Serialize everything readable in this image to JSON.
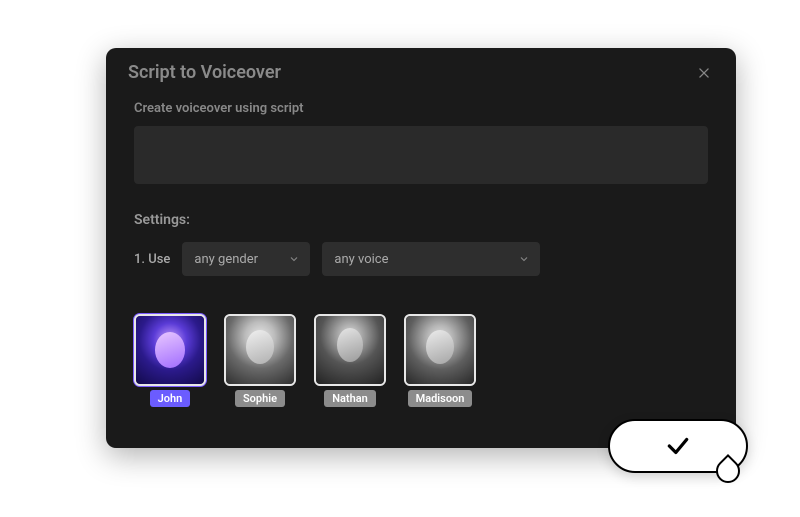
{
  "modal": {
    "title": "Script to Voiceover",
    "script_label": "Create voiceover using script",
    "script_value": "",
    "settings_label": "Settings:",
    "row_prefix": "1. Use",
    "gender_select": {
      "value": "any gender"
    },
    "voice_select": {
      "value": "any voice"
    }
  },
  "voices": [
    {
      "name": "John",
      "selected": true
    },
    {
      "name": "Sophie",
      "selected": false
    },
    {
      "name": "Nathan",
      "selected": false
    },
    {
      "name": "Madisoon",
      "selected": false
    }
  ]
}
